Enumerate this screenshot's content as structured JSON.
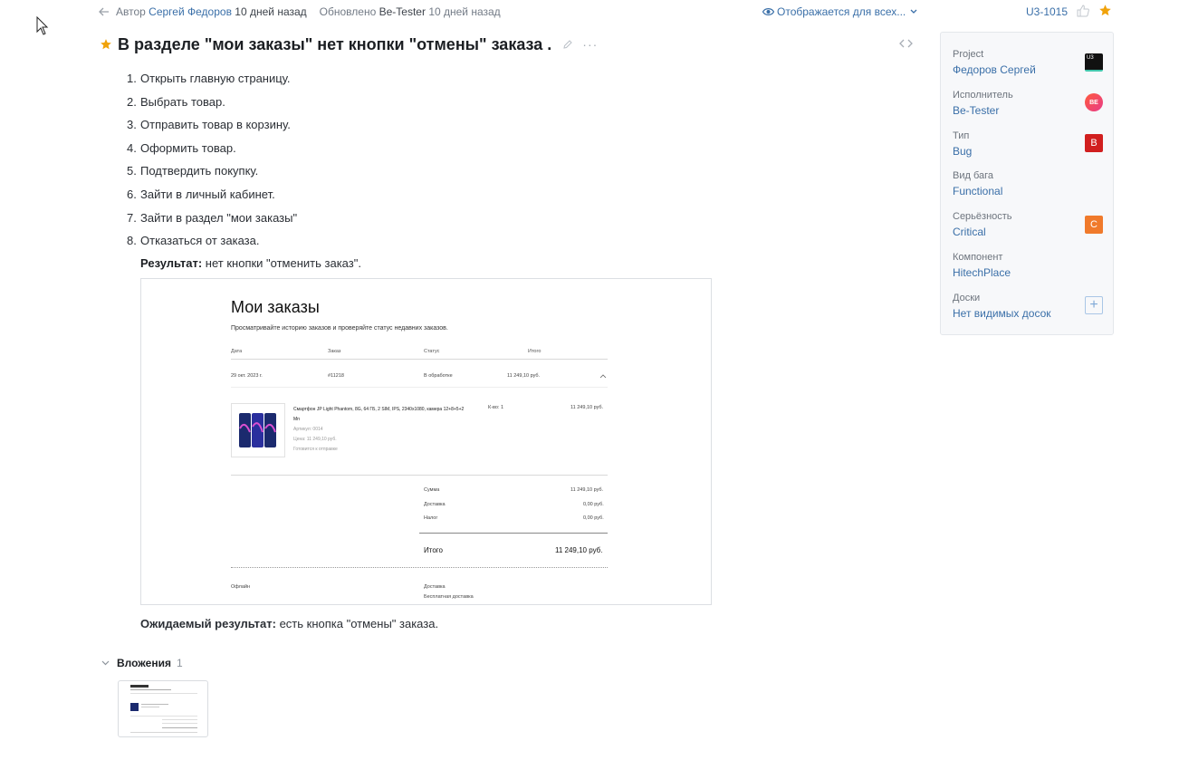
{
  "meta": {
    "author_prefix": "Автор",
    "author_name": "Сергей Федоров",
    "author_time": "10 дней назад",
    "updated_prefix": "Обновлено",
    "updated_by": "Be-Tester",
    "updated_time": "10 дней назад",
    "visibility": "Отображается для всех...",
    "issue_id": "U3-1015"
  },
  "issue": {
    "title": "В разделе \"мои заказы\" нет кнопки \"отмены\" заказа ."
  },
  "steps": [
    {
      "num": "1.",
      "text": "Открыть главную страницу."
    },
    {
      "num": "2.",
      "text": "Выбрать товар."
    },
    {
      "num": "3.",
      "text": "Отправить товар в корзину."
    },
    {
      "num": "4.",
      "text": "Оформить товар."
    },
    {
      "num": "5.",
      "text": "Подтвердить покупку."
    },
    {
      "num": "6.",
      "text": "Зайти в личный кабинет."
    },
    {
      "num": "7.",
      "text": "Зайти в раздел \"мои заказы\""
    },
    {
      "num": "8.",
      "text": "Отказаться от заказа."
    }
  ],
  "result": {
    "label": "Результат:",
    "text": " нет кнопки \"отменить заказ\"."
  },
  "expected": {
    "label": "Ожидаемый результат:",
    "text": " есть кнопка \"отмены\" заказа."
  },
  "screenshot": {
    "heading": "Мои заказы",
    "subtitle": "Просматривайте историю заказов и проверяйте статус недавних заказов.",
    "columns": [
      "Дата",
      "Заказ",
      "Статус",
      "Итого"
    ],
    "order": {
      "date": "29 окт. 2023 г.",
      "number": "#11218",
      "status": "В обработке",
      "total": "11 249,10 руб."
    },
    "product": {
      "name": "Смартфон JP Light Phantom, 8G, 64 ГБ, 2 SIM, IPS, 2340x1080, камера 12+8+5+2 Мп",
      "article": "Артикул: 0014",
      "price": "Цена: 11 249,10 руб.",
      "ready": "Готовится к отправке",
      "qty": "К-во: 1",
      "sum": "11 249,10 руб."
    },
    "summary": [
      {
        "label": "Сумма",
        "value": "11 249,10 руб."
      },
      {
        "label": "Доставка",
        "value": "0,00 руб."
      },
      {
        "label": "Налог",
        "value": "0,00 руб."
      }
    ],
    "grand_total_label": "Итого",
    "grand_total_value": "11 249,10 руб.",
    "payment": "Офлайн",
    "delivery_label": "Доставка",
    "delivery_value": "Бесплатная доставка"
  },
  "attachments": {
    "label": "Вложения",
    "count": "1"
  },
  "panel": {
    "fields": [
      {
        "label": "Project",
        "value": "Федоров Сергей",
        "badge": "U3"
      },
      {
        "label": "Исполнитель",
        "value": "Be-Tester",
        "badge": "BE"
      },
      {
        "label": "Тип",
        "value": "Bug",
        "badge": "B"
      },
      {
        "label": "Вид бага",
        "value": "Functional",
        "badge": ""
      },
      {
        "label": "Серьёзность",
        "value": "Critical",
        "badge": "C"
      },
      {
        "label": "Компонент",
        "value": "HitechPlace",
        "badge": ""
      },
      {
        "label": "Доски",
        "value": "Нет видимых досок",
        "badge": "+"
      }
    ]
  },
  "colors": {
    "link": "#3a6fa8",
    "star": "#f0a20a",
    "bug": "#d11f1f",
    "critical": "#f07a2b"
  }
}
